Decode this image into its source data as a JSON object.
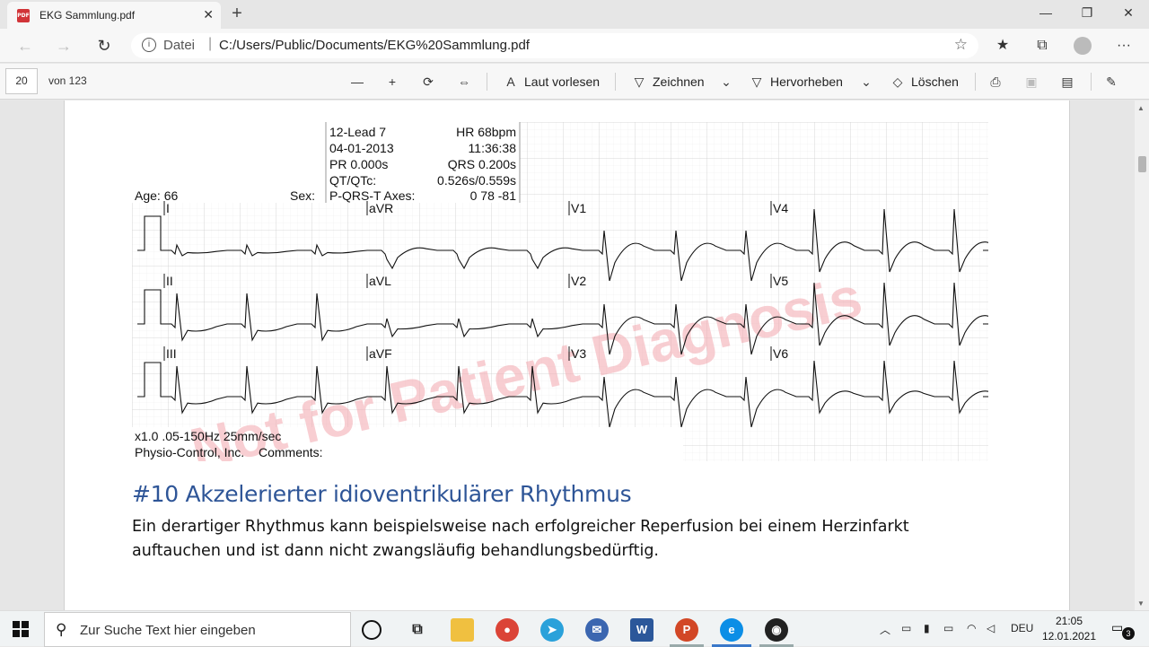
{
  "browser": {
    "tab_title": "EKG Sammlung.pdf",
    "address_scheme": "Datei",
    "address_url": "C:/Users/Public/Documents/EKG%20Sammlung.pdf"
  },
  "pdf_toolbar": {
    "page_current": "20",
    "page_total": "von 123",
    "read_aloud": "Laut vorlesen",
    "draw": "Zeichnen",
    "highlight": "Hervorheben",
    "erase": "Löschen"
  },
  "ekg": {
    "header": {
      "lead_label": "12-Lead 7",
      "hr": "HR 68bpm",
      "date": "04-01-2013",
      "time": "11:36:38",
      "pr": "PR 0.000s",
      "qrs": "QRS 0.200s",
      "qt_label": "QT/QTc:",
      "qt_value": "0.526s/0.559s",
      "axes_label": "P-QRS-T Axes:",
      "axes_value": "0 78 -81",
      "age": "Age: 66",
      "sex": "Sex:"
    },
    "leads": [
      "I",
      "aVR",
      "V1",
      "V4",
      "II",
      "aVL",
      "V2",
      "V5",
      "III",
      "aVF",
      "V3",
      "V6"
    ],
    "watermark": "Not for Patient Diagnosis",
    "footer_settings": "x1.0 .05-150Hz 25mm/sec",
    "footer_company": "Physio-Control, Inc.",
    "footer_comments": "Comments:"
  },
  "document": {
    "heading": "#10 Akzelerierter idioventrikulärer Rhythmus",
    "body": "Ein derartiger Rhythmus kann beispielsweise nach erfolgreicher Reperfusion bei einem Herzinfarkt auftauchen und ist dann nicht zwangsläufig behandlungsbedürftig."
  },
  "taskbar": {
    "search_placeholder": "Zur Suche Text hier eingeben",
    "language": "DEU",
    "time": "21:05",
    "date": "12.01.2021",
    "notifications": "3"
  },
  "colors": {
    "heading": "#2e5597",
    "watermark": "#f2a5ad",
    "grid_major": "#cfcfcf",
    "grid_minor": "#ececec",
    "trace": "#111111",
    "app_edge": "#0c8ee6",
    "app_word": "#2b579a",
    "app_ppt": "#d24726",
    "app_chrome": "#db4437",
    "app_telegram": "#2aa1da"
  }
}
